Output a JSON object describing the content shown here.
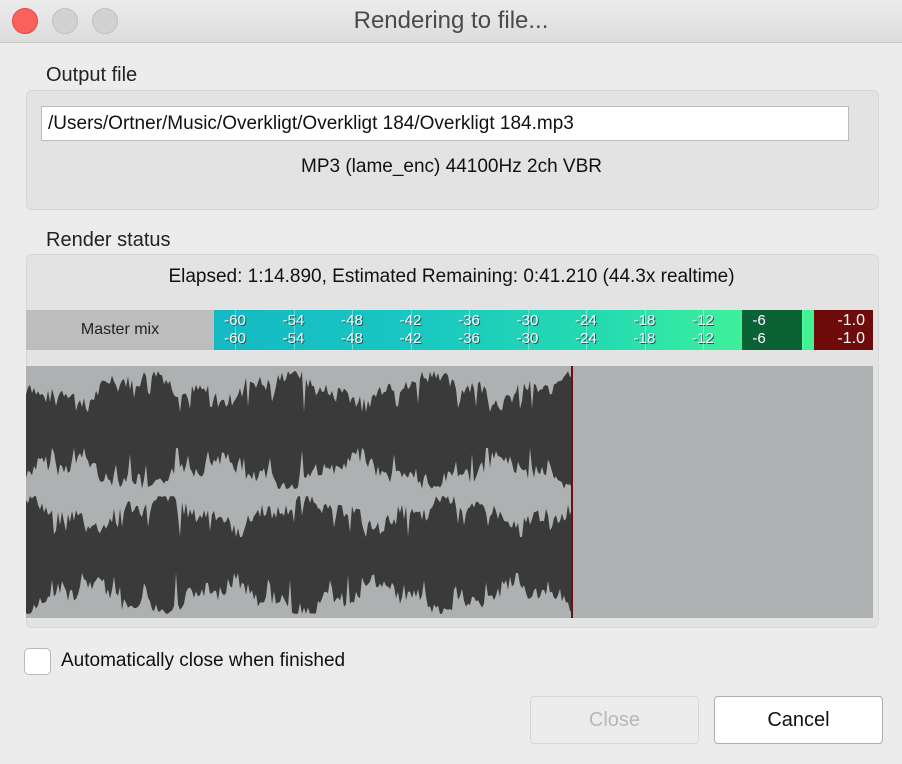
{
  "window": {
    "title": "Rendering to file..."
  },
  "output_file": {
    "label": "Output file",
    "path": "/Users/Ortner/Music/Overkligt/Overkligt 184/Overkligt 184.mp3",
    "format": "MP3 (lame_enc) 44100Hz 2ch VBR"
  },
  "render_status": {
    "label": "Render status",
    "elapsed_text": "Elapsed: 1:14.890, Estimated Remaining: 0:41.210 (44.3x realtime)",
    "meter": {
      "label": "Master mix",
      "ticks": [
        "-60",
        "-54",
        "-48",
        "-42",
        "-36",
        "-30",
        "-24",
        "-18",
        "-12"
      ],
      "green_value": "-6",
      "peak_left": "-1.0",
      "peak_right": "-1.0"
    },
    "progress_fraction": 0.645
  },
  "options": {
    "auto_close_label": "Automatically close when finished",
    "auto_close_checked": false
  },
  "buttons": {
    "close_label": "Close",
    "close_enabled": false,
    "cancel_label": "Cancel"
  },
  "colors": {
    "waveform": "#3a3a3a",
    "waveform_bg": "#aeb1b2",
    "playhead": "#6b0f0f",
    "meter_clip": "#6e0b0b",
    "meter_green": "#0b6234"
  }
}
